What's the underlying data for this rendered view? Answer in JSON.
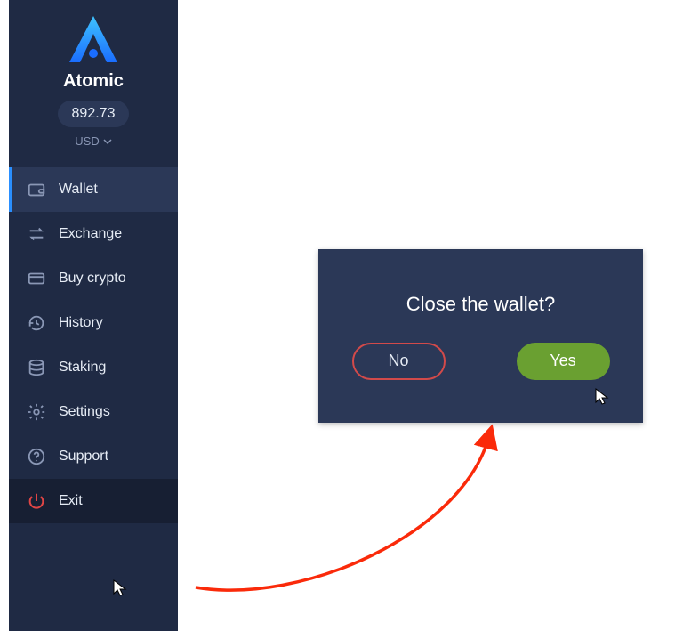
{
  "brand": {
    "name": "Atomic"
  },
  "balance": {
    "amount": "892.73",
    "currency": "USD"
  },
  "sidebar": {
    "items": [
      {
        "label": "Wallet"
      },
      {
        "label": "Exchange"
      },
      {
        "label": "Buy crypto"
      },
      {
        "label": "History"
      },
      {
        "label": "Staking"
      },
      {
        "label": "Settings"
      },
      {
        "label": "Support"
      },
      {
        "label": "Exit"
      }
    ]
  },
  "dialog": {
    "title": "Close the wallet?",
    "no_label": "No",
    "yes_label": "Yes"
  },
  "colors": {
    "sidebar_bg": "#1f2a44",
    "accent_blue": "#2a8fff",
    "exit_red": "#e04545",
    "yes_green": "#6aa031",
    "no_border": "#d24a4a",
    "arrow": "#fa2a0a"
  }
}
